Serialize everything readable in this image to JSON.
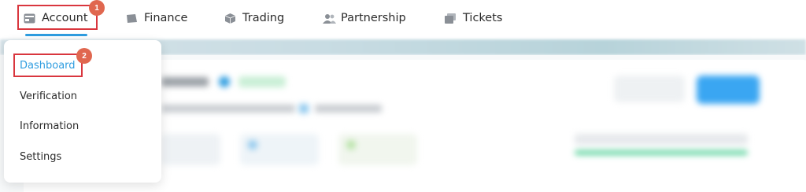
{
  "nav": {
    "items": [
      {
        "label": "Account",
        "icon": "wallet-icon"
      },
      {
        "label": "Finance",
        "icon": "card-icon"
      },
      {
        "label": "Trading",
        "icon": "cube-icon"
      },
      {
        "label": "Partnership",
        "icon": "users-icon"
      },
      {
        "label": "Tickets",
        "icon": "tickets-icon"
      }
    ]
  },
  "annotations": {
    "step1": "1",
    "step2": "2"
  },
  "dropdown": {
    "items": [
      {
        "label": "Dashboard"
      },
      {
        "label": "Verification"
      },
      {
        "label": "Information"
      },
      {
        "label": "Settings"
      }
    ]
  },
  "colors": {
    "accent": "#2f9de0",
    "highlight_border": "#d9363e",
    "badge": "#e0674f",
    "progress": "#5dd39e"
  }
}
